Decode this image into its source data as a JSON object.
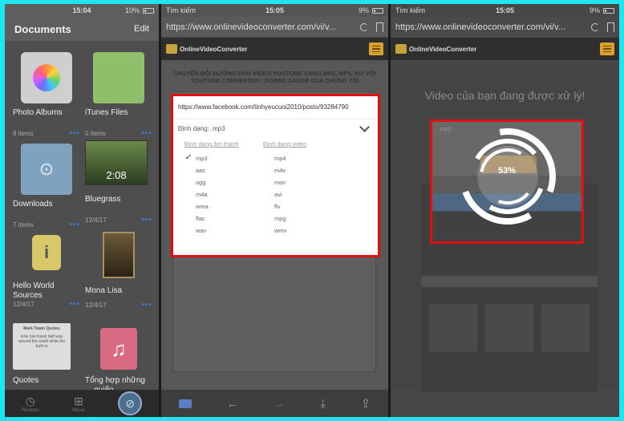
{
  "panel1": {
    "status": {
      "time": "15:04",
      "battery": "10%"
    },
    "header": {
      "title": "Documents",
      "edit_label": "Edit"
    },
    "tiles": [
      {
        "name": "Photo Albums",
        "meta": "8 items",
        "icon": "photos-icon"
      },
      {
        "name": "iTunes Files",
        "meta": "0 items",
        "icon": "folder-icon"
      },
      {
        "name": "Downloads",
        "meta": "7 items",
        "icon": "download-folder-icon"
      },
      {
        "name": "Bluegrass",
        "meta": "12/4/17",
        "icon": "video-icon",
        "duration": "2:08"
      },
      {
        "name": "Hello World Sources",
        "meta": "12/4/17",
        "icon": "info-icon"
      },
      {
        "name": "Mona Lisa",
        "meta": "12/4/17",
        "icon": "image-icon"
      },
      {
        "name": "Quotes",
        "meta": "",
        "icon": "text-icon",
        "preview_title": "Mark Twain Quotes",
        "preview_body": "A lie can travel half way around the world while the truth is"
      },
      {
        "name": "Tổng hợp những ... quiếo",
        "meta": "",
        "icon": "music-icon"
      }
    ],
    "tabs": [
      "Recents",
      "Music",
      "Browser"
    ]
  },
  "panel2": {
    "status": {
      "carrier": "Tìm kiếm",
      "time": "15:05",
      "battery": "9%"
    },
    "url": "https://www.onlinevideoconverter.com/vi/v...",
    "logo": "OnlineVideoConverter",
    "heading": "CHUYỂN ĐỔI ĐƯỜNG DẪN VIDEO YOUTUBE SANG MP3, MP4, AVI VỚI YOUTUBE CONVERTER / DOWNLOADER CỦA CHÚNG TÔI",
    "popup": {
      "input_url": "https://www.facebook.com/tinhyeucuoi2010/posts/93284790",
      "format_label": "Định dạng: .mp3",
      "audio_header": "Định dạng âm thanh",
      "video_header": "Định dạng video",
      "audio": [
        "mp3",
        "aac",
        "ogg",
        "m4a",
        "wma",
        "flac",
        "wav"
      ],
      "video": [
        "mp4",
        "m4v",
        "mov",
        "avi",
        "flv",
        "mpg",
        "wmv"
      ],
      "selected": "mp3"
    }
  },
  "panel3": {
    "status": {
      "carrier": "Tìm kiếm",
      "time": "15:05",
      "battery": "9%"
    },
    "url": "https://www.onlinevideoconverter.com/vi/v...",
    "logo": "OnlineVideoConverter",
    "processing_text": "Video của bạn đang được xử lý!",
    "progress_percent": 53,
    "progress_label": "53%",
    "overlay_label": ".mp3"
  }
}
